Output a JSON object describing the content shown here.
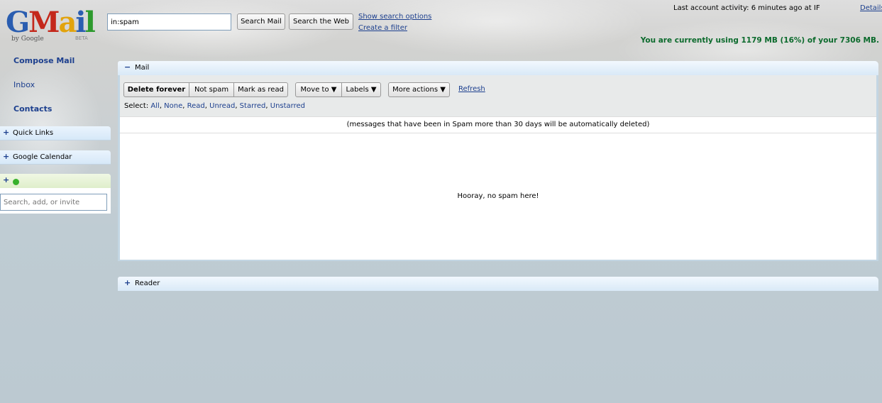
{
  "logo": {
    "g": "G",
    "mail_a": "a",
    "mail_i": "i",
    "mail_l": "l",
    "by": "by Google",
    "beta": "BETA"
  },
  "search": {
    "query": "in:spam",
    "search_mail_label": "Search Mail",
    "search_web_label": "Search the Web",
    "show_options_link": "Show search options",
    "create_filter_link": "Create a filter"
  },
  "account": {
    "last_activity": "Last account activity: 6 minutes ago at IF",
    "details_link": "Details",
    "quota": "You are currently using 1179 MB (16%) of your 7306 MB."
  },
  "sidebar": {
    "compose": "Compose Mail",
    "inbox": "Inbox",
    "contacts": "Contacts",
    "quick_links": "Quick Links",
    "google_calendar": "Google Calendar",
    "chat_input_placeholder": "Search, add, or invite",
    "plus": "+"
  },
  "mail_panel": {
    "toggle": "−",
    "title": "Mail",
    "toolbar": {
      "delete_forever": "Delete forever",
      "not_spam": "Not spam",
      "mark_as_read": "Mark as read",
      "move_to": "Move to ▼",
      "labels": "Labels ▼",
      "more_actions": "More actions ▼",
      "refresh": "Refresh"
    },
    "select": {
      "label": "Select:",
      "all": "All",
      "none": "None",
      "read": "Read",
      "unread": "Unread",
      "starred": "Starred",
      "unstarred": "Unstarred"
    },
    "spam_note": "(messages that have been in Spam more than 30 days will be automatically deleted)",
    "empty_message": "Hooray, no spam here!"
  },
  "reader_panel": {
    "toggle": "+",
    "title": "Reader"
  },
  "colors": {
    "link": "#1c3f8e",
    "quota_green": "#0b6a2c",
    "chat_status_green": "#37b12b",
    "panel_header": "#d9e9f7"
  }
}
